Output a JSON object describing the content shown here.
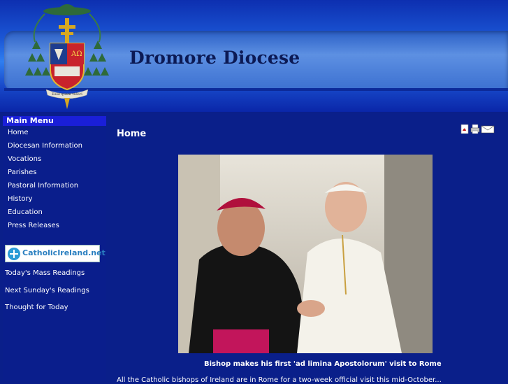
{
  "header": {
    "site_title": "Dromore Diocese",
    "crest_motto": "Esse quam videri"
  },
  "sidebar": {
    "menu_title": "Main Menu",
    "items": [
      {
        "label": "Home"
      },
      {
        "label": "Diocesan Information"
      },
      {
        "label": "Vocations"
      },
      {
        "label": "Parishes"
      },
      {
        "label": "Pastoral Information"
      },
      {
        "label": "History"
      },
      {
        "label": "Education"
      },
      {
        "label": "Press Releases"
      }
    ],
    "banner_text": "CatholicIreland.net",
    "links": [
      {
        "label": "Today's Mass Readings"
      },
      {
        "label": "Next Sunday's Readings"
      },
      {
        "label": "Thought for Today"
      }
    ]
  },
  "main": {
    "page_title": "Home",
    "toolbar_icons": [
      "pdf-icon",
      "print-icon",
      "email-icon"
    ],
    "photo_caption": "Bishop makes his first 'ad limina Apostolorum' visit to Rome",
    "body_text": "All the Catholic bishops of Ireland are in Rome for a two-week official visit this mid-October..."
  },
  "colors": {
    "page_bg": "#0a1f8a",
    "menu_title_bg": "#1a1fd8",
    "header_blue": "#2f7ef0"
  }
}
